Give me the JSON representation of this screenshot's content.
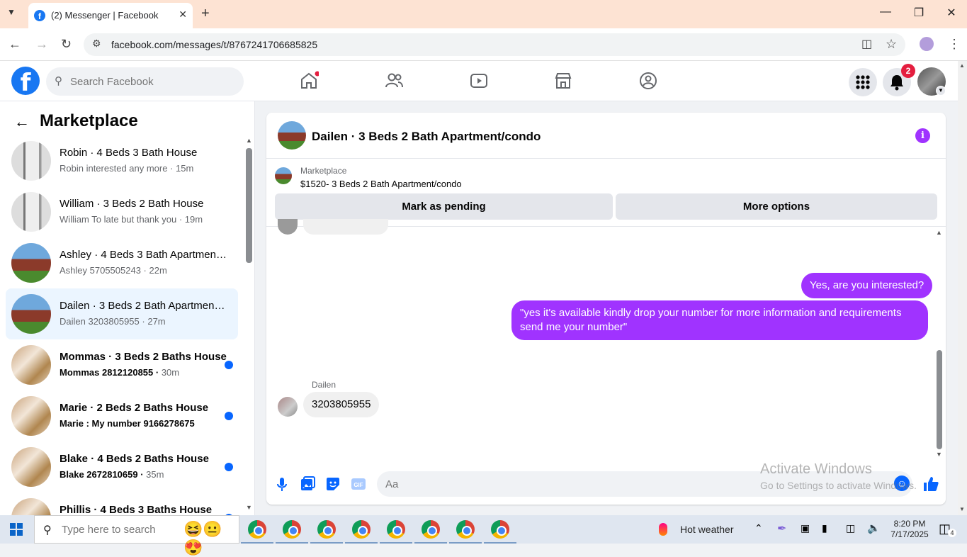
{
  "browser": {
    "tab_title": "(2) Messenger | Facebook",
    "url": "facebook.com/messages/t/8767241706685825"
  },
  "fb": {
    "search_placeholder": "Search Facebook",
    "notification_count": "2"
  },
  "sidebar": {
    "heading": "Marketplace",
    "conversations": [
      {
        "name": "Robin · 4 Beds 3 Bath House",
        "preview": "Robin interested any more",
        "time": "15m",
        "unread": false
      },
      {
        "name": "William · 3 Beds 2 Bath House",
        "preview": "William To late but thank you",
        "time": "19m",
        "unread": false
      },
      {
        "name": "Ashley · 4 Beds 3 Bath Apartment/condo",
        "preview": "Ashley 5705505243",
        "time": "22m",
        "unread": false
      },
      {
        "name": "Dailen · 3 Beds 2 Bath Apartment/condo",
        "preview": "Dailen 3203805955",
        "time": "27m",
        "unread": false
      },
      {
        "name": "Mommas · 3 Beds 2 Baths House",
        "preview": "Mommas 2812120855",
        "time": "30m",
        "unread": true
      },
      {
        "name": "Marie · 2 Beds 2 Baths House",
        "preview": "Marie : My number 9166278675",
        "time": "",
        "unread": true
      },
      {
        "name": "Blake · 4 Beds 2 Baths House",
        "preview": "Blake 2672810659",
        "time": "35m",
        "unread": true
      },
      {
        "name": "Phillis · 4 Beds 3 Baths House",
        "preview": "",
        "time": "",
        "unread": true
      }
    ]
  },
  "chat": {
    "title": "Dailen · 3 Beds 2 Bath Apartment/condo",
    "marketplace_label": "Marketplace",
    "listing": "$1520- 3 Beds 2 Bath Apartment/condo",
    "mark_pending": "Mark as pending",
    "more_options": "More options",
    "messages": {
      "out1": "Yes, are you interested?",
      "out2": "\"yes it's available kindly drop your number for more information and requirements send me your number\"",
      "sender": "Dailen",
      "in1": "3203805955"
    },
    "composer_placeholder": "Aa"
  },
  "watermark": {
    "line1": "Activate Windows",
    "line2": "Go to Settings to activate Windows."
  },
  "taskbar": {
    "search_placeholder": "Type here to search",
    "weather": "Hot weather",
    "time": "8:20 PM",
    "date": "7/17/2025",
    "notif_count": "4"
  },
  "colors": {
    "fb_blue": "#1877f2",
    "messenger_purple": "#a033ff",
    "unread_dot": "#0866ff",
    "badge_red": "#e41e3f"
  }
}
